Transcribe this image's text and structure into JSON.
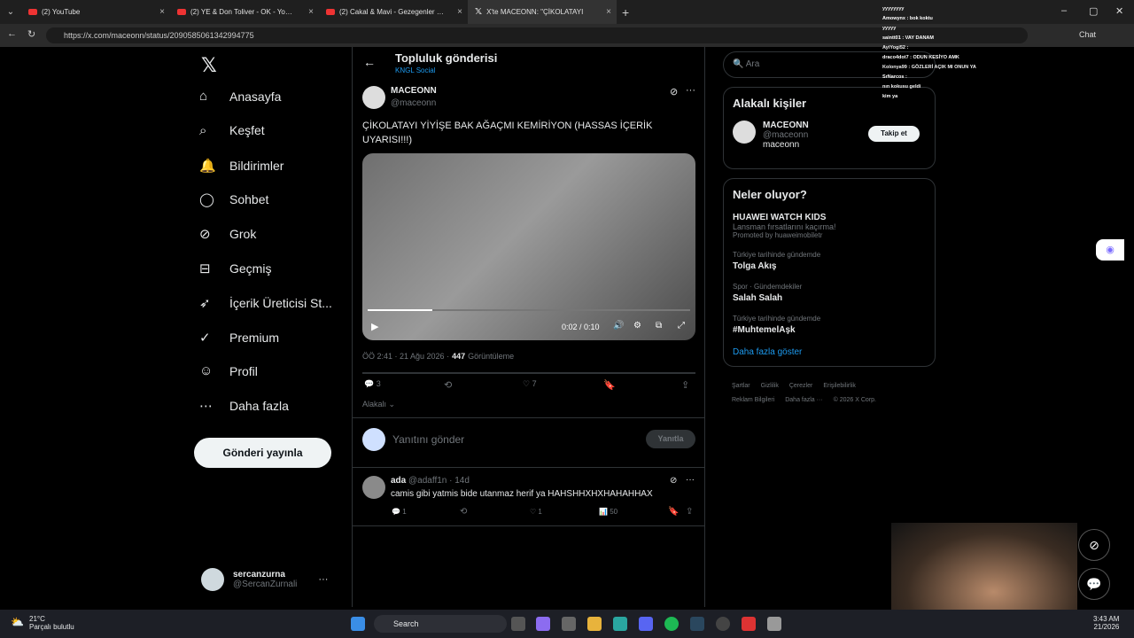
{
  "browser": {
    "tabs": [
      {
        "label": "(2) YouTube"
      },
      {
        "label": "(2) YE & Don Toliver - OK - YouTube"
      },
      {
        "label": "(2) Cakal & Mavi - Gezegenler Birbir"
      },
      {
        "label": "X'te MACEONN: \"ÇİKOLATAYI"
      }
    ],
    "url": "https://x.com/maceonn/status/2090585061342994775"
  },
  "nav": [
    "Anasayfa",
    "Keşfet",
    "Bildirimler",
    "Sohbet",
    "Grok",
    "Geçmiş",
    "İçerik Üreticisi St...",
    "Premium",
    "Profil",
    "Daha fazla"
  ],
  "post_button": "Gönderi yayınla",
  "me": {
    "name": "sercanzurna",
    "handle": "@SercanZurnali",
    "more": "···"
  },
  "header": {
    "title": "Topluluk gönderisi",
    "sub": "KNGL Social"
  },
  "tweet": {
    "name": "MACEONN",
    "handle": "@maceonn",
    "text": "ÇİKOLATAYI YİYİŞE BAK AĞAÇMI KEMİRİYON (HASSAS İÇERİK UYARISI!!!)",
    "time": "0:02 / 0:10",
    "meta": "ÖÖ 2:41 · 21 Ağu 2026 ·",
    "views": "447",
    "views_label": "Görüntüleme",
    "replies": "3",
    "likes": "7",
    "relevant": "Alakalı"
  },
  "reply_box": {
    "placeholder": "Yanıtını gönder",
    "button": "Yanıtla"
  },
  "reply": {
    "name": "ada",
    "handle": "@adaff1n · 14d",
    "text": "camis gibi yatmis bide utanmaz herif ya HAHSHHXHXHAHAHHAX",
    "replies": "1",
    "likes": "1",
    "views": "50"
  },
  "search": {
    "placeholder": "Ara"
  },
  "related": {
    "title": "Alakalı kişiler",
    "name": "MACEONN",
    "handle": "@maceonn",
    "bio": "maceonn",
    "follow": "Takip et"
  },
  "trends": {
    "title": "Neler oluyor?",
    "items": [
      {
        "cat": "",
        "name": "HUAWEI WATCH KIDS",
        "extra": "Lansman fırsatlarını kaçırma!",
        "promo": "Promoted by huaweimobiletr"
      },
      {
        "cat": "Türkiye tarihinde gündemde",
        "name": "Tolga Akış"
      },
      {
        "cat": "Spor · Gündemdekiler",
        "name": "Salah Salah"
      },
      {
        "cat": "Türkiye tarihinde gündemde",
        "name": "#MuhtemelAşk"
      }
    ],
    "more": "Daha fazla göster"
  },
  "footer": [
    "Şartlar",
    "Gizlilik",
    "Çerezler",
    "Erişilebilirlik",
    "Reklam Bilgileri",
    "Daha fazla ···",
    "© 2026 X Corp."
  ],
  "chat": [
    "yyyyyyyy",
    "Amowynx : bok koktu",
    "yyyyy",
    "saintt01 : VAY DANAM",
    "AyiYogi52 :",
    "draco4dot7 : ODUN KESİYO AMK",
    "Kolonya99 : GÖZLERİ AÇIK MI ONUN YA",
    "SrNarcos :",
    "nın kokusu geldi",
    "kim ya"
  ],
  "taskbar": {
    "weather": "21°C",
    "weather_sub": "Parçalı bulutlu",
    "search": "Search",
    "time": "3:43 AM",
    "date": "21/2026"
  },
  "chrome": {
    "chat": "Chat"
  }
}
